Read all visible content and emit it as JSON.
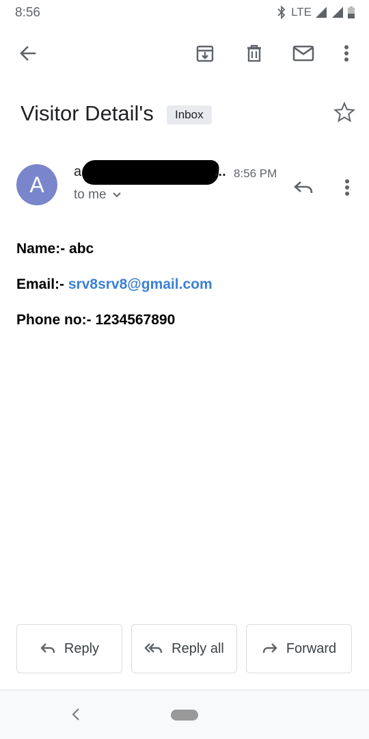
{
  "status_bar": {
    "time": "8:56",
    "network": "LTE"
  },
  "toolbar": {
    "icons": [
      "back-arrow-icon",
      "archive-icon",
      "delete-icon",
      "mail-icon",
      "more-vert-icon"
    ]
  },
  "email": {
    "subject": "Visitor Detail's",
    "label": "Inbox",
    "sender_visible": "a",
    "sender_truncation": "...",
    "avatar_letter": "A",
    "avatar_color": "#7986cb",
    "time": "8:56 PM",
    "recipient": "to me",
    "body": {
      "name_label": "Name:- ",
      "name_value": "abc",
      "email_label": "Email:- ",
      "email_value": "srv8srv8@gmail.com",
      "phone_label": "Phone no:- ",
      "phone_value": "1234567890"
    }
  },
  "actions": {
    "reply": "Reply",
    "reply_all": "Reply all",
    "forward": "Forward"
  },
  "colors": {
    "link": "#3b80d4",
    "icon": "#5f6368"
  }
}
